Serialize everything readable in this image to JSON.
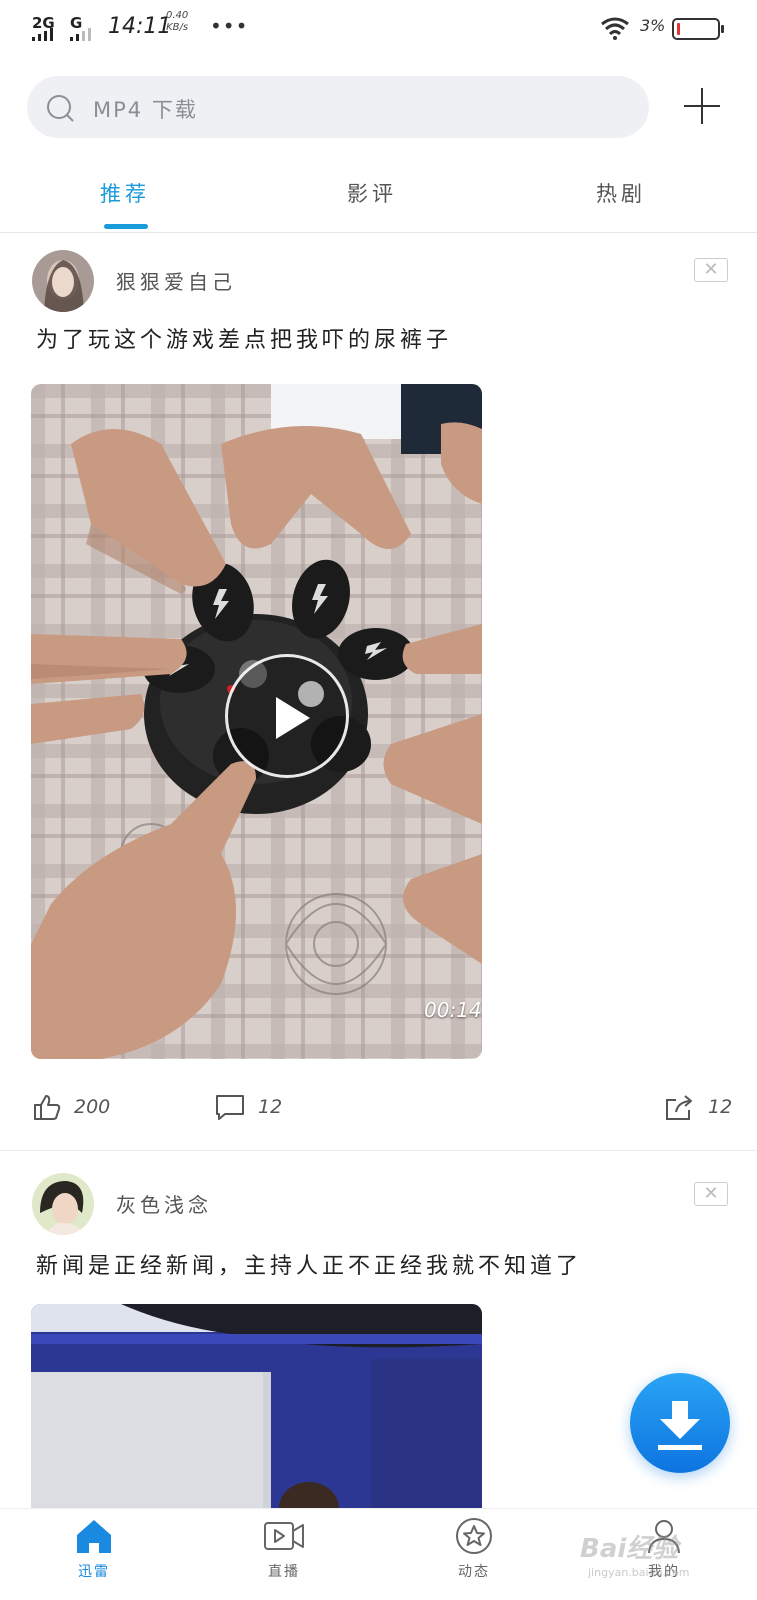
{
  "status_bar": {
    "network1": "2G",
    "network2": "G",
    "time": "14:11",
    "speed_value": "0.40",
    "speed_unit": "KB/s",
    "more": "•••",
    "battery_percent": "3%",
    "battery_level": 0.03,
    "battery_color": "#e33333"
  },
  "search": {
    "placeholder": "MP4 下载",
    "add_icon": "plus-icon"
  },
  "tabs": [
    {
      "label": "推荐",
      "active": true
    },
    {
      "label": "影评",
      "active": false
    },
    {
      "label": "热剧",
      "active": false
    }
  ],
  "posts": [
    {
      "author": "狠狠爱自己",
      "title": "为了玩这个游戏差点把我吓的尿裤子",
      "duration": "00:14",
      "close": "✕",
      "likes": "200",
      "comments": "12",
      "shares": "12"
    },
    {
      "author": "灰色浅念",
      "title": "新闻是正经新闻，主持人正不正经我就不知道了",
      "close": "✕"
    }
  ],
  "bottom_nav": [
    {
      "label": "迅雷",
      "icon": "home-icon",
      "active": true
    },
    {
      "label": "直播",
      "icon": "video-camera-icon",
      "active": false
    },
    {
      "label": "动态",
      "icon": "star-icon",
      "active": false
    },
    {
      "label": "我的",
      "icon": "profile-icon",
      "active": false
    }
  ],
  "watermark": {
    "text": "Bai经验",
    "sub": "jingyan.baidu.com"
  },
  "colors": {
    "accent": "#1a9bdb",
    "fab": "#1480e8"
  }
}
